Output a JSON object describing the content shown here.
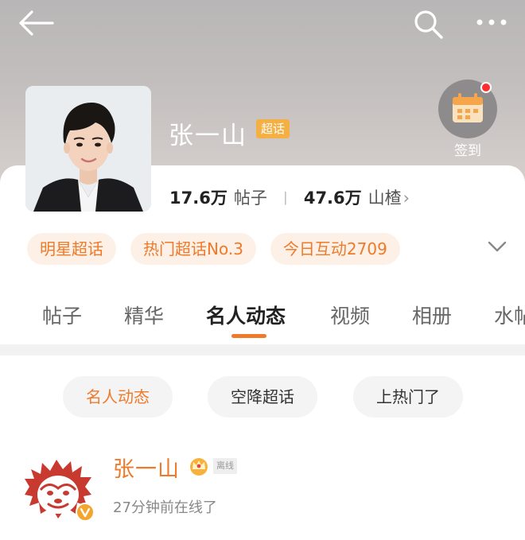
{
  "header": {
    "topic_name": "张一山",
    "topic_badge": "超话",
    "checkin_label": "签到"
  },
  "stats": {
    "posts_count": "17.6万",
    "posts_label": "帖子",
    "separator": "丨",
    "hawthorn_count": "47.6万",
    "hawthorn_label": "山楂",
    "chevron": "›"
  },
  "tags": [
    "明星超话",
    "热门超话No.3",
    "今日互动2709"
  ],
  "tabs": [
    "帖子",
    "精华",
    "名人动态",
    "视频",
    "相册",
    "水帖"
  ],
  "active_tab": "名人动态",
  "filters": [
    "名人动态",
    "空降超话",
    "上热门了"
  ],
  "post": {
    "username": "张一山",
    "status_badge": "离线",
    "meta": "27分钟前在线了"
  },
  "colors": {
    "accent": "#ef7a2a",
    "badge": "#f4b042",
    "checkin_dot": "#ff2d2d"
  },
  "icons": {
    "back": "back-arrow-icon",
    "search": "search-icon",
    "more": "more-icon",
    "checkin": "calendar-icon",
    "expand": "chevron-down-icon",
    "crown": "crown-icon",
    "verified": "verified-icon"
  }
}
